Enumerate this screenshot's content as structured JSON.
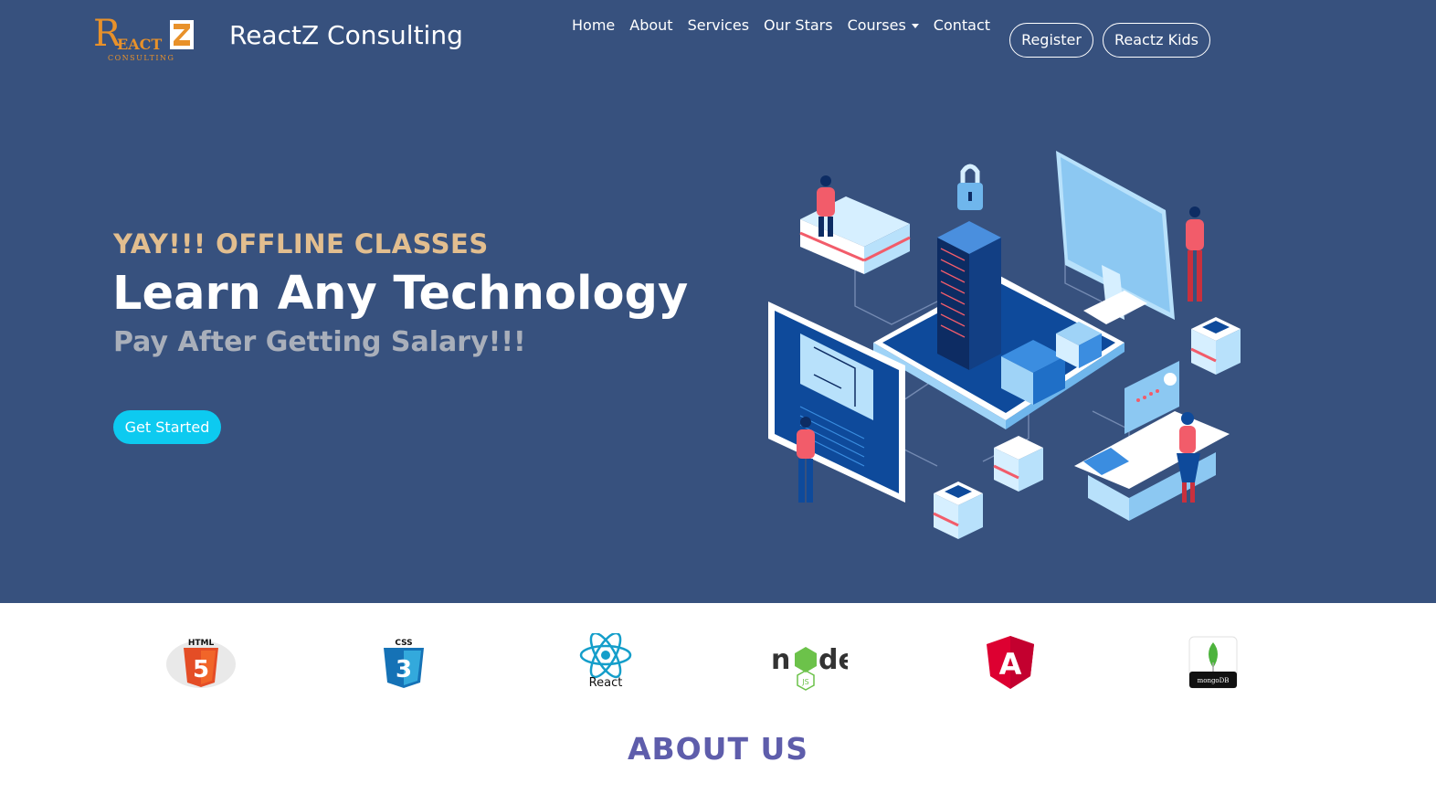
{
  "header": {
    "logo": {
      "main": "REACTZ",
      "sub": "CONSULTING"
    },
    "brand": "ReactZ Consulting",
    "nav": [
      "Home",
      "About",
      "Services",
      "Our Stars",
      "Courses",
      "Contact"
    ],
    "register_label": "Register",
    "kids_label": "Reactz Kids"
  },
  "hero": {
    "tagline": "YAY!!! OFFLINE CLASSES",
    "headline": "Learn Any Technology",
    "subheadline": "Pay After Getting Salary!!!",
    "cta_label": "Get Started"
  },
  "tech_logos": [
    {
      "name": "html5",
      "text": "HTML"
    },
    {
      "name": "css3",
      "text": "CSS"
    },
    {
      "name": "react",
      "text": "React"
    },
    {
      "name": "nodejs",
      "text": "node"
    },
    {
      "name": "angular",
      "text": "A"
    },
    {
      "name": "mongodb",
      "text": "mongoDB"
    }
  ],
  "section_title": "ABOUT US",
  "colors": {
    "hero_bg": "#37517e",
    "tagline": "#e2be8f",
    "cta": "#0dcaf0",
    "section_title": "#5e5dab"
  }
}
